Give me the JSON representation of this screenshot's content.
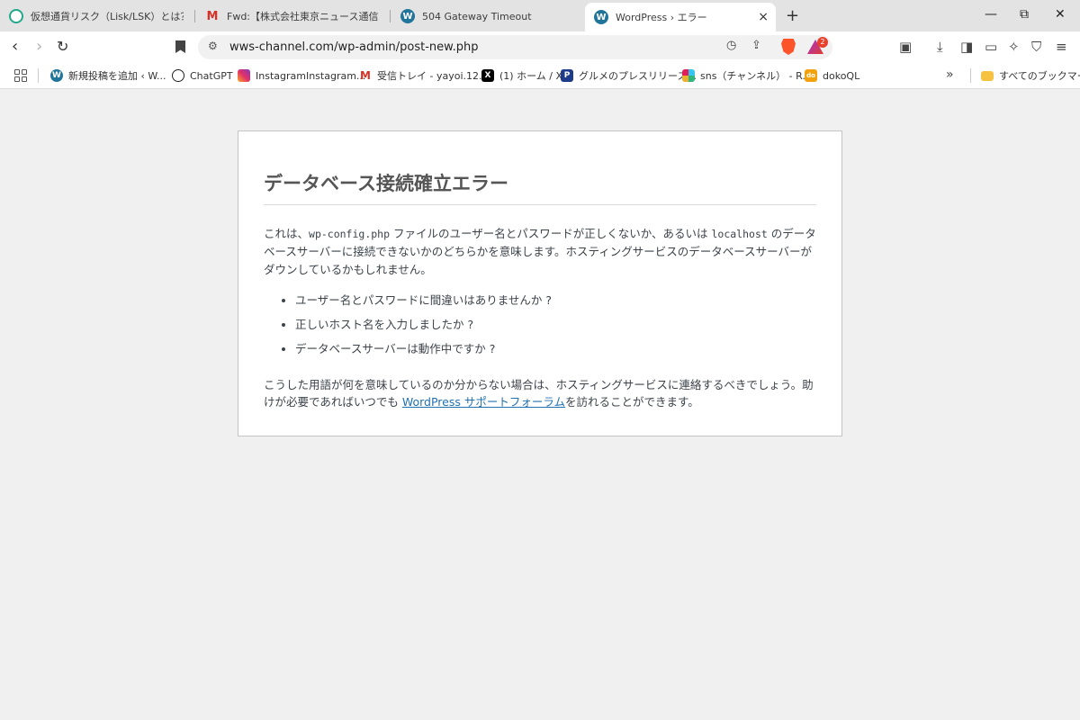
{
  "tabs": [
    {
      "title": "仮想通貨リスク（Lisk/LSK）とは？特徴",
      "icon": "chatgpt-green-icon",
      "active": false
    },
    {
      "title": "Fwd:【株式会社東京ニュース通信社】「&",
      "icon": "gmail-icon",
      "active": false
    },
    {
      "title": "504 Gateway Timeout",
      "icon": "wordpress-icon",
      "active": false
    },
    {
      "title": "WordPress › エラー",
      "icon": "wordpress-icon",
      "active": true
    }
  ],
  "tab_strip": {
    "new_tab": "+",
    "close_tab": "×",
    "minimize": "—",
    "restore": "⧉",
    "close_window": "✕"
  },
  "address_bar": {
    "url": "wws-channel.com/wp-admin/post-new.php",
    "rewards_badge": "2"
  },
  "bookmarks": [
    {
      "label": "新規投稿を追加 ‹ W...",
      "icon": "wordpress-icon"
    },
    {
      "label": "ChatGPT",
      "icon": "chatgpt-icon"
    },
    {
      "label": "InstagramInstagram...",
      "icon": "instagram-icon"
    },
    {
      "label": "受信トレイ - yayoi.12...",
      "icon": "gmail-icon"
    },
    {
      "label": "(1) ホーム / X",
      "icon": "x-icon"
    },
    {
      "label": "グルメのプレスリリース...",
      "icon": "p-icon"
    },
    {
      "label": "sns（チャンネル） - R...",
      "icon": "slack-icon"
    },
    {
      "label": "dokoQL",
      "icon": "dokoql-icon"
    }
  ],
  "bookmarks_more": "»",
  "all_bookmarks": "すべてのブックマーク",
  "error": {
    "title": "データベース接続確立エラー",
    "p1_a": "これは、",
    "p1_code1": "wp-config.php",
    "p1_b": " ファイルのユーザー名とパスワードが正しくないか、あるいは ",
    "p1_code2": "localhost",
    "p1_c": " のデータベースサーバーに接続できないかのどちらかを意味します。ホスティングサービスのデータベースサーバーがダウンしているかもしれません。",
    "list": [
      "ユーザー名とパスワードに間違いはありませんか ?",
      "正しいホスト名を入力しましたか ?",
      "データベースサーバーは動作中ですか ?"
    ],
    "p2_a": "こうした用語が何を意味しているのか分からない場合は、ホスティングサービスに連絡するべきでしょう。助けが必要であればいつでも ",
    "p2_link": "WordPress サポートフォーラム",
    "p2_b": "を訪れることができます。"
  }
}
